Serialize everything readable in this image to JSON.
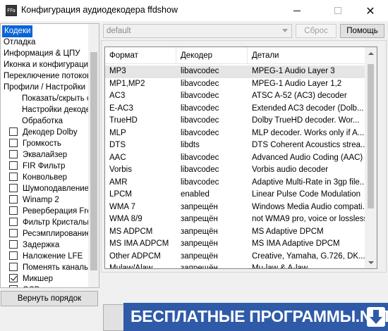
{
  "window": {
    "title": "Конфигурация аудиодекодера ffdshow",
    "icon_text": "FFa"
  },
  "tree": {
    "items": [
      {
        "label": "Кодеки",
        "selected": true,
        "checkbox": null
      },
      {
        "label": "Отладка",
        "checkbox": null
      },
      {
        "label": "Информация & ЦПУ",
        "checkbox": null
      },
      {
        "label": "Иконка и конфигурация",
        "checkbox": null
      },
      {
        "label": "Переключение потоков",
        "checkbox": null
      },
      {
        "label": "Профили / Настройки п",
        "checkbox": null
      },
      {
        "label": "Показать/скрыть с",
        "checkbox": null,
        "indent": 2
      },
      {
        "label": "Настройки декоде",
        "checkbox": null,
        "indent": 2
      },
      {
        "label": "Обработка",
        "checkbox": null,
        "indent": 2
      },
      {
        "label": "Декодер Dolby",
        "checkbox": false
      },
      {
        "label": "Громкость",
        "checkbox": false
      },
      {
        "label": "Эквалайзер",
        "checkbox": false
      },
      {
        "label": "FIR Фильтр",
        "checkbox": false
      },
      {
        "label": "Конвольвер",
        "checkbox": false
      },
      {
        "label": "Шумоподавление",
        "checkbox": false
      },
      {
        "label": "Winamp 2",
        "checkbox": false
      },
      {
        "label": "Реверберация Free",
        "checkbox": false
      },
      {
        "label": "Фильтр Кристальн",
        "checkbox": false
      },
      {
        "label": "Ресэмплирование",
        "checkbox": false
      },
      {
        "label": "Задержка",
        "checkbox": false
      },
      {
        "label": "Наложение LFE",
        "checkbox": false
      },
      {
        "label": "Поменять каналы н",
        "checkbox": false
      },
      {
        "label": "Микшер",
        "checkbox": true
      },
      {
        "label": "OSD",
        "checkbox": false
      }
    ],
    "restore_button": "Вернуть порядок"
  },
  "toolbar": {
    "preset_value": "default",
    "reset_label": "Сброс",
    "help_label": "Помощь"
  },
  "codecs": {
    "columns": [
      "Формат",
      "Декодер",
      "Детали"
    ],
    "rows": [
      [
        "MP3",
        "libavcodec",
        "MPEG-1 Audio Layer 3"
      ],
      [
        "MP1,MP2",
        "libavcodec",
        "MPEG-1 Audio Layer 1,2"
      ],
      [
        "AC3",
        "libavcodec",
        "ATSC A-52 (AC3) decoder"
      ],
      [
        "E-AC3",
        "libavcodec",
        "Extended AC3 decoder (Dolb..."
      ],
      [
        "TrueHD",
        "libavcodec",
        "Dolby TrueHD decoder. Wor..."
      ],
      [
        "MLP",
        "libavcodec",
        "MLP decoder. Works only if A..."
      ],
      [
        "DTS",
        "libdts",
        "DTS Coherent Acoustics strea..."
      ],
      [
        "AAC",
        "libavcodec",
        "Advanced Audio Coding (AAC)"
      ],
      [
        "Vorbis",
        "libavcodec",
        "Vorbis audio decoder"
      ],
      [
        "AMR",
        "libavcodec",
        "Adaptive Multi-Rate in 3gp file..."
      ],
      [
        "LPCM",
        "enabled",
        "Linear Pulse Code Modulation"
      ],
      [
        "WMA 7",
        "запрещён",
        "Windows Media Audio compati..."
      ],
      [
        "WMA 8/9",
        "запрещён",
        "not WMA9 pro, voice or lossless"
      ],
      [
        "MS ADPCM",
        "запрещён",
        "MS Adaptive DPCM"
      ],
      [
        "MS IMA ADPCM",
        "запрещён",
        "MS IMA Adaptive DPCM"
      ],
      [
        "Other ADPCM",
        "запрещён",
        "Creative, Yamaha, G.726, DK..."
      ],
      [
        "Mulaw/Alaw",
        "запрещён",
        "Mu-law & A-law"
      ]
    ],
    "selected_row": 0
  },
  "banner": {
    "text": "БЕСПЛАТНЫЕ ПРОГРАММЫ.NET",
    "color": "#2e5aa8"
  }
}
